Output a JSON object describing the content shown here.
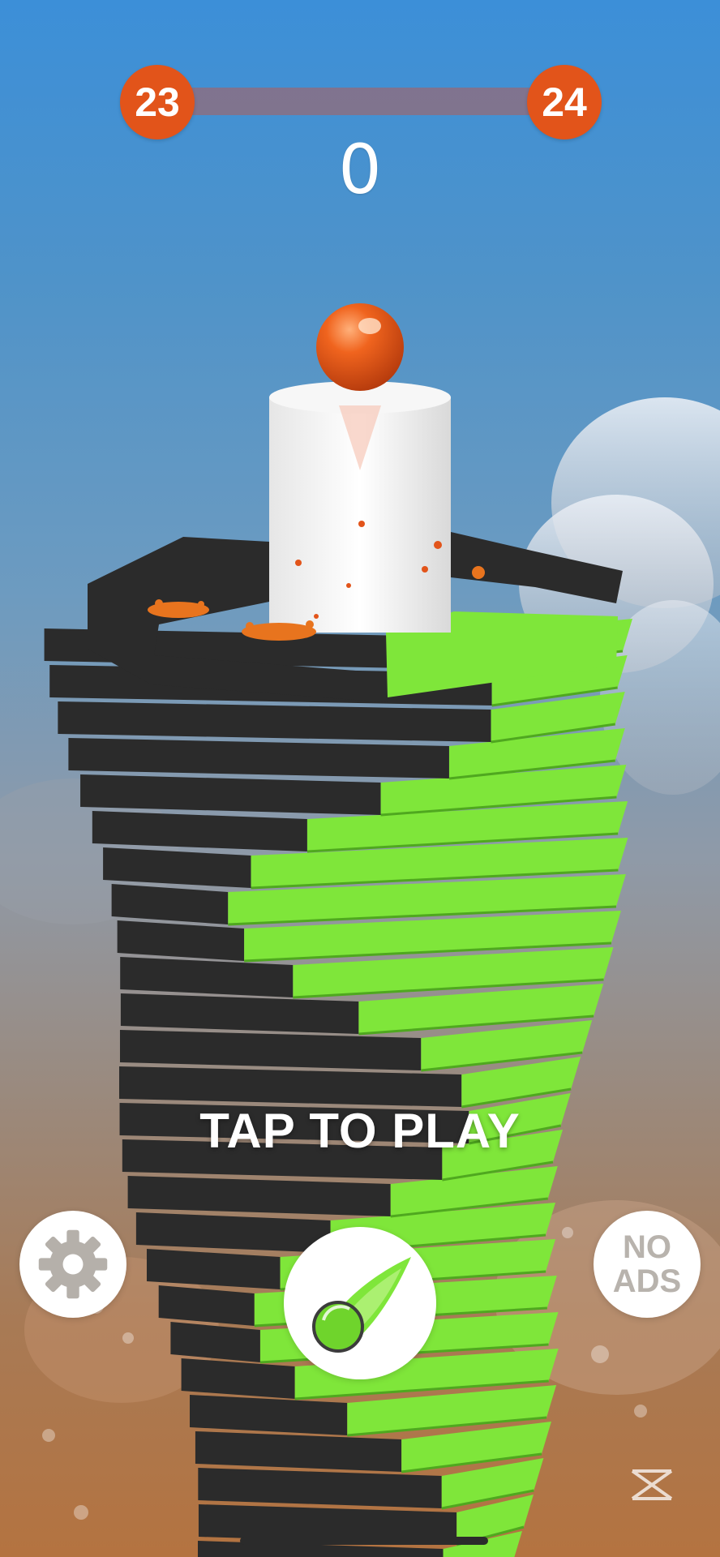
{
  "hud": {
    "current_level": "23",
    "next_level": "24",
    "level_progress": 0,
    "score": "0"
  },
  "prompt": {
    "tap_to_play": "TAP TO PLAY"
  },
  "buttons": {
    "settings_icon": "gear-icon",
    "ball_skin_icon": "comet-ball-icon",
    "no_ads_label": "NO\nADS"
  },
  "colors": {
    "accent": "#e2541a",
    "platform_green": "#7fe63a",
    "platform_black": "#2b2b2b",
    "pole": "#f2f2f2"
  }
}
